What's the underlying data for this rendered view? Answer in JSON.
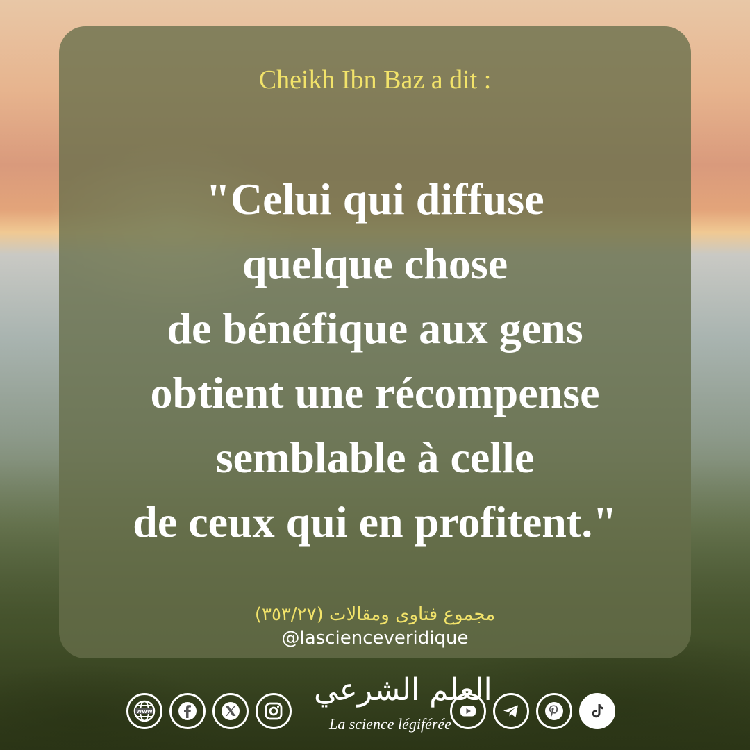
{
  "post": {
    "intro": "Cheikh Ibn Baz a dit :",
    "quote_lines": [
      "\"Celui qui diffuse",
      "quelque chose",
      "de bénéfique aux gens",
      "obtient une récompense",
      "semblable à celle",
      "de ceux qui en profitent.\""
    ],
    "source": "مجموع فتاوى ومقالات (٣٥٣/٢٧)",
    "handle": "@lascienceveridique"
  },
  "branding": {
    "logo_arabic": "العلم الشرعي",
    "logo_tagline": "La science légiférée"
  },
  "social_icons": [
    "website-icon",
    "facebook-icon",
    "x-icon",
    "instagram-icon",
    "youtube-icon",
    "telegram-icon",
    "pinterest-icon",
    "tiktok-icon"
  ],
  "colors": {
    "accent_yellow": "#f2e36a",
    "text_white": "#ffffff",
    "card_overlay": "#666e4a"
  }
}
